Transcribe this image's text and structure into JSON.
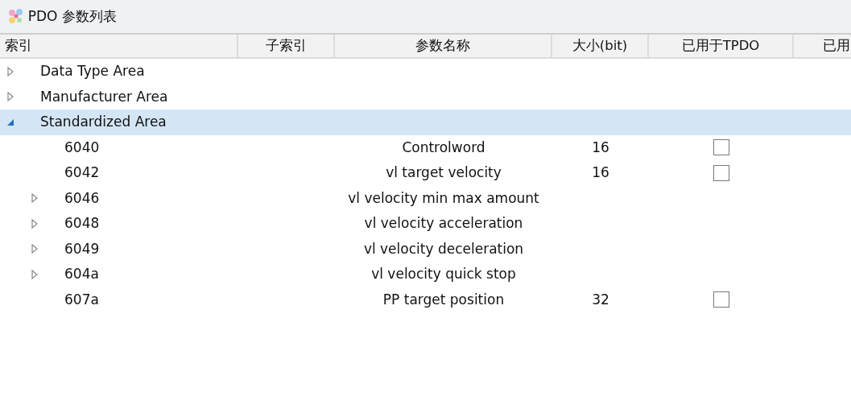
{
  "window": {
    "title": "PDO 参数列表"
  },
  "table": {
    "columns": [
      "索引",
      "子索引",
      "参数名称",
      "大小(bit)",
      "已用于TPDO",
      "已用"
    ],
    "rows": [
      {
        "index": "Data Type Area",
        "kind": "group",
        "expanded": false,
        "selected": false
      },
      {
        "index": "Manufacturer Area",
        "kind": "group",
        "expanded": false,
        "selected": false
      },
      {
        "index": "Standardized Area",
        "kind": "group",
        "expanded": true,
        "selected": true,
        "children": [
          {
            "index": "6040",
            "kind": "entry",
            "name": "Controlword",
            "size": "16",
            "checked": false
          },
          {
            "index": "6042",
            "kind": "entry",
            "name": "vl target velocity",
            "size": "16",
            "checked": false
          },
          {
            "index": "6046",
            "kind": "group",
            "expanded": false,
            "name": "vl velocity min max amount"
          },
          {
            "index": "6048",
            "kind": "group",
            "expanded": false,
            "name": "vl velocity acceleration"
          },
          {
            "index": "6049",
            "kind": "group",
            "expanded": false,
            "name": "vl velocity deceleration"
          },
          {
            "index": "604a",
            "kind": "group",
            "expanded": false,
            "name": "vl velocity quick stop"
          },
          {
            "index": "607a",
            "kind": "entry",
            "name": "PP target position",
            "size": "32",
            "checked": false
          }
        ]
      }
    ]
  }
}
